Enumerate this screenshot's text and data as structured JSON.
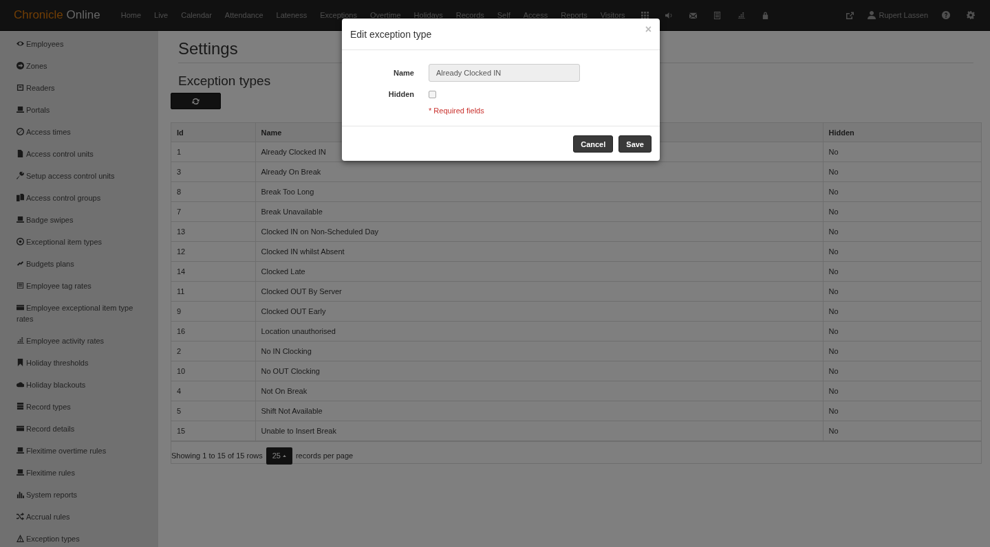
{
  "navbar": {
    "brand_first": "Chronicle",
    "brand_second": "Online",
    "links": [
      "Home",
      "Live",
      "Calendar",
      "Attendance",
      "Lateness",
      "Exceptions",
      "Overtime",
      "Holidays",
      "Records",
      "Self",
      "Access",
      "Reports",
      "Visitors"
    ],
    "user": "Rupert Lassen"
  },
  "sidebar": {
    "items": [
      "Employees",
      "Zones",
      "Readers",
      "Portals",
      "Access times",
      "Access control units",
      "Setup access control units",
      "Access control groups",
      "Badge swipes",
      "Exceptional item types",
      "Budgets plans",
      "Employee tag rates",
      "Employee exceptional item type rates",
      "Employee activity rates",
      "Holiday thresholds",
      "Holiday blackouts",
      "Record types",
      "Record details",
      "Flexitime overtime rules",
      "Flexitime rules",
      "System reports",
      "Accrual rules",
      "Exception types"
    ]
  },
  "page": {
    "title": "Settings",
    "subtitle": "Exception types"
  },
  "table": {
    "columns": [
      "Id",
      "Name",
      "Hidden"
    ],
    "rows": [
      [
        "1",
        "Already Clocked IN",
        "No"
      ],
      [
        "3",
        "Already On Break",
        "No"
      ],
      [
        "8",
        "Break Too Long",
        "No"
      ],
      [
        "7",
        "Break Unavailable",
        "No"
      ],
      [
        "13",
        "Clocked IN on Non-Scheduled Day",
        "No"
      ],
      [
        "12",
        "Clocked IN whilst Absent",
        "No"
      ],
      [
        "14",
        "Clocked Late",
        "No"
      ],
      [
        "11",
        "Clocked OUT By Server",
        "No"
      ],
      [
        "9",
        "Clocked OUT Early",
        "No"
      ],
      [
        "16",
        "Location unauthorised",
        "No"
      ],
      [
        "2",
        "No IN Clocking",
        "No"
      ],
      [
        "10",
        "No OUT Clocking",
        "No"
      ],
      [
        "4",
        "Not On Break",
        "No"
      ],
      [
        "5",
        "Shift Not Available",
        "No"
      ],
      [
        "15",
        "Unable to Insert Break",
        "No"
      ]
    ],
    "footer": {
      "showing": "Showing 1 to 15 of 15 rows",
      "page_size": "25",
      "suffix": "records per page"
    }
  },
  "modal": {
    "title": "Edit exception type",
    "close": "×",
    "name_label": "Name",
    "name_value": "Already Clocked IN",
    "hidden_label": "Hidden",
    "hidden_checked": false,
    "required_note": "* Required fields",
    "buttons": [
      "Cancel",
      "Save"
    ]
  }
}
